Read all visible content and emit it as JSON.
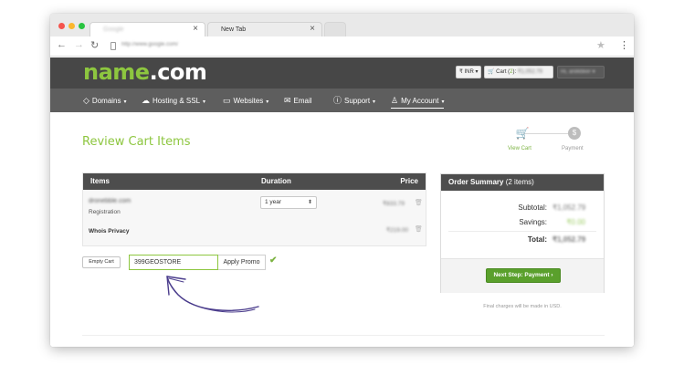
{
  "browser": {
    "tabs": [
      {
        "label": "Google",
        "active": true
      },
      {
        "label": "New Tab",
        "active": false
      }
    ],
    "tab_close_glyph": "×",
    "address": "http://www.google.com/",
    "icons": {
      "back": "back-arrow-icon",
      "forward": "forward-arrow-icon",
      "reload": "reload-icon",
      "bookmark": "star-icon",
      "menu": "kebab-menu-icon"
    }
  },
  "header": {
    "logo_name": "name",
    "logo_dot": ".",
    "logo_tld": "com",
    "currency": "₹ INR ▾",
    "cart_label": "Cart (",
    "cart_count": "2",
    "cart_close": "):",
    "cart_total": "₹1,052.79",
    "user": "Hi, anilkbker ▾"
  },
  "nav": {
    "items": [
      {
        "label": "Domains"
      },
      {
        "label": "Hosting & SSL"
      },
      {
        "label": "Websites"
      },
      {
        "label": "Email"
      },
      {
        "label": "Support"
      },
      {
        "label": "My Account"
      }
    ]
  },
  "page": {
    "title": "Review Cart Items",
    "steps": {
      "cart": "View Cart",
      "payment": "Payment"
    }
  },
  "cart": {
    "columns": {
      "items": "Items",
      "duration": "Duration",
      "price": "Price"
    },
    "domain": "dronebble.com",
    "item_type": "Registration",
    "privacy": "Whois Privacy",
    "duration": "1 year",
    "domain_price": "₹833.79",
    "privacy_price": "₹219.00",
    "empty_cart": "Empty Cart",
    "promo_code": "399GEOSTORE",
    "apply_promo": "Apply Promo"
  },
  "summary": {
    "title": "Order Summary",
    "count": "(2 items)",
    "subtotal_label": "Subtotal:",
    "subtotal": "₹1,052.79",
    "savings_label": "Savings:",
    "savings": "₹0.00",
    "total_label": "Total:",
    "total": "₹1,052.79",
    "next_button": "Next Step: Payment",
    "note": "Final charges will be made in USD."
  },
  "colors": {
    "brand_green": "#8dc63f",
    "header": "#474747",
    "nav": "#5e5e5e",
    "button_green": "#5aa02c",
    "annotation": "#4a3c8c"
  }
}
